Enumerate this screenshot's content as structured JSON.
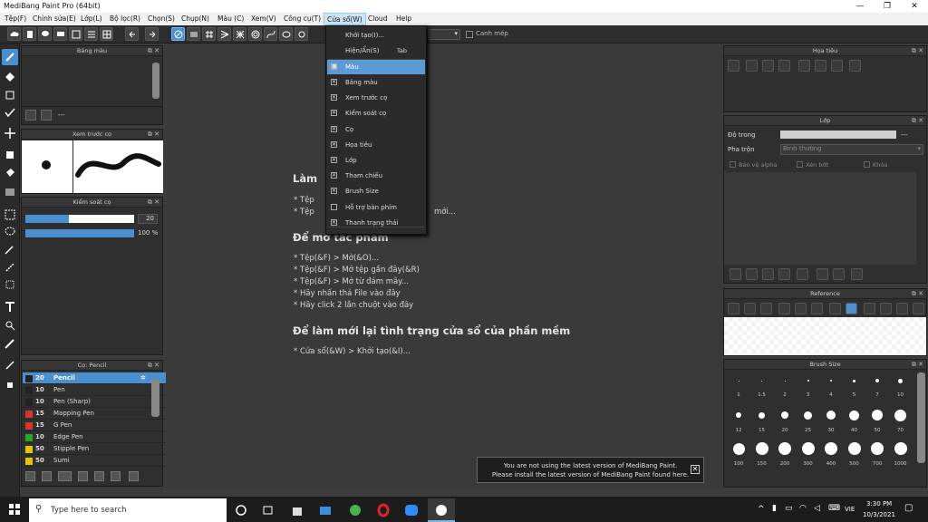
{
  "window": {
    "title": "MediBang Paint Pro (64bit)"
  },
  "menu": [
    "Tệp(F)",
    "Chỉnh sửa(E)",
    "Lớp(L)",
    "Bộ lọc(R)",
    "Chọn(S)",
    "Chụp(N)",
    "Màu (C)",
    "Xem(V)",
    "Công cụ(T)",
    "Cửa sổ(W)",
    "Cloud",
    "Help"
  ],
  "toolbar": {
    "cursor_label": "Canh mép"
  },
  "dropdown": {
    "items": [
      {
        "label": "Khởi tạo(I)...",
        "check": "",
        "accel": ""
      },
      {
        "label": "Hiện/Ẩn(S)",
        "check": "",
        "accel": "Tab"
      },
      {
        "label": "Màu",
        "check": "■",
        "accel": ""
      },
      {
        "label": "Bảng màu",
        "check": "✕",
        "accel": ""
      },
      {
        "label": "Xem trước cọ",
        "check": "✕",
        "accel": ""
      },
      {
        "label": "Kiểm soát cọ",
        "check": "✕",
        "accel": ""
      },
      {
        "label": "Cọ",
        "check": "✕",
        "accel": ""
      },
      {
        "label": "Họa tiêu",
        "check": "✕",
        "accel": ""
      },
      {
        "label": "Lớp",
        "check": "✕",
        "accel": ""
      },
      {
        "label": "Tham chiếu",
        "check": "✕",
        "accel": ""
      },
      {
        "label": "Brush Size",
        "check": "✕",
        "accel": ""
      },
      {
        "label": "Hỗ trợ bàn phím",
        "check": "",
        "accel": ""
      },
      {
        "label": "Thanh trạng thái",
        "check": "✕",
        "accel": ""
      }
    ]
  },
  "panels": {
    "palette": {
      "title": "Bảng màu",
      "footer": "---"
    },
    "preview": {
      "title": "Xem trước cọ"
    },
    "control": {
      "title": "Kiểm soát cọ",
      "size": "20",
      "opacity": "100 %",
      "size_fill": 0.4,
      "opacity_fill": 1.0
    },
    "brush": {
      "title": "Cọ: Pencil",
      "items": [
        {
          "size": "20",
          "name": "Pencil",
          "color": "#222222"
        },
        {
          "size": "10",
          "name": "Pen",
          "color": "#222222"
        },
        {
          "size": "10",
          "name": "Pen (Sharp)",
          "color": "#222222"
        },
        {
          "size": "15",
          "name": "Mapping Pen",
          "color": "#e03030"
        },
        {
          "size": "15",
          "name": "G Pen",
          "color": "#e03030"
        },
        {
          "size": "10",
          "name": "Edge Pen",
          "color": "#22aa22"
        },
        {
          "size": "50",
          "name": "Stipple Pen",
          "color": "#e8c400"
        },
        {
          "size": "50",
          "name": "Sumi",
          "color": "#e8c400"
        }
      ]
    },
    "pattern": {
      "title": "Họa tiêu"
    },
    "layer": {
      "title": "Lớp",
      "opacity_label": "Độ trong",
      "opacity_value": "---",
      "blend_label": "Pha trộn",
      "blend_value": "Bình thường",
      "opt1": "Bảo vệ alpha",
      "opt2": "Xén bớt",
      "opt3": "Khóa"
    },
    "reference": {
      "title": "Reference"
    },
    "brushsize": {
      "title": "Brush Size",
      "sizes": [
        "1",
        "1.5",
        "2",
        "3",
        "4",
        "5",
        "7",
        "10",
        "12",
        "15",
        "20",
        "25",
        "30",
        "40",
        "50",
        "70",
        "100",
        "150",
        "200",
        "300",
        "400",
        "500",
        "700",
        "1000"
      ]
    }
  },
  "canvas": {
    "h1": "Làm",
    "line1": "* Tệp",
    "line2": "* Tệp",
    "line2b": "mới...",
    "h2": "Để mở tác phẩm",
    "open_lines": [
      "* Tệp(&F) > Mở(&O)...",
      "* Tệp(&F) > Mở tệp gần đây(&R)",
      "* Tệp(&F) > Mở từ đám mây...",
      "* Hãy nhấn thả File vào đây",
      "* Hãy click 2 lần chuột vào đây"
    ],
    "h3": "Để làm mới lại tình trạng cửa sổ của phần mềm",
    "reset_line": "* Cửa sổ(&W) > Khởi tạo(&I)..."
  },
  "notice": {
    "line1": "You are not using the latest version of MediBang Paint.",
    "line2": "Please install the latest version of MediBang Paint found here."
  },
  "taskbar": {
    "search_placeholder": "Type here to search",
    "lang": "VIE",
    "time": "3:30 PM",
    "date": "10/3/2021"
  }
}
